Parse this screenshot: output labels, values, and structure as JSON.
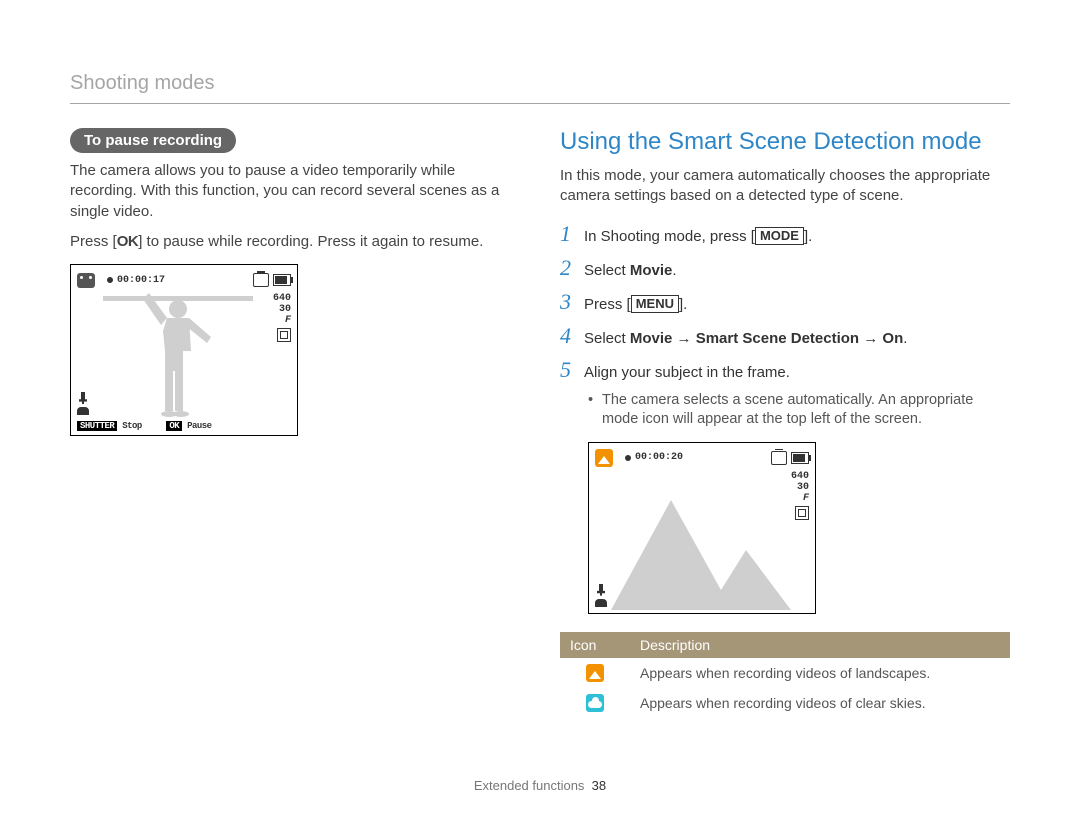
{
  "breadcrumb": "Shooting modes",
  "left": {
    "pill": "To pause recording",
    "para1": "The camera allows you to pause a video temporarily while recording. With this function, you can record several scenes as a single video.",
    "press_pre": "Press [",
    "ok": "OK",
    "press_post": "] to pause while recording. Press it again to resume.",
    "shot": {
      "time": "00:00:17",
      "res": "640",
      "fps": "30",
      "f": "F",
      "shutter_label": "SHUTTER",
      "stop": "Stop",
      "ok2": "OK",
      "pause": "Pause"
    }
  },
  "right": {
    "title": "Using the Smart Scene Detection mode",
    "intro": "In this mode, your camera automatically chooses the appropriate camera settings based on a detected type of scene.",
    "steps": {
      "s1_pre": "In Shooting mode, press [",
      "s1_btn": "MODE",
      "s1_post": "].",
      "s2_pre": "Select ",
      "s2_bold": "Movie",
      "s2_post": ".",
      "s3_pre": "Press [",
      "s3_btn": "MENU",
      "s3_post": "].",
      "s4_pre": "Select ",
      "s4_bold": "Movie → Smart Scene Detection → On",
      "s4_post": ".",
      "s5": "Align your subject in the frame."
    },
    "bullet": "The camera selects a scene automatically. An appropriate mode icon will appear at the top left of the screen.",
    "shot": {
      "time": "00:00:20",
      "res": "640",
      "fps": "30",
      "f": "F"
    },
    "table": {
      "h1": "Icon",
      "h2": "Description",
      "r1": "Appears when recording videos of landscapes.",
      "r2": "Appears when recording videos of clear skies."
    }
  },
  "footer": {
    "section": "Extended functions",
    "page": "38"
  }
}
